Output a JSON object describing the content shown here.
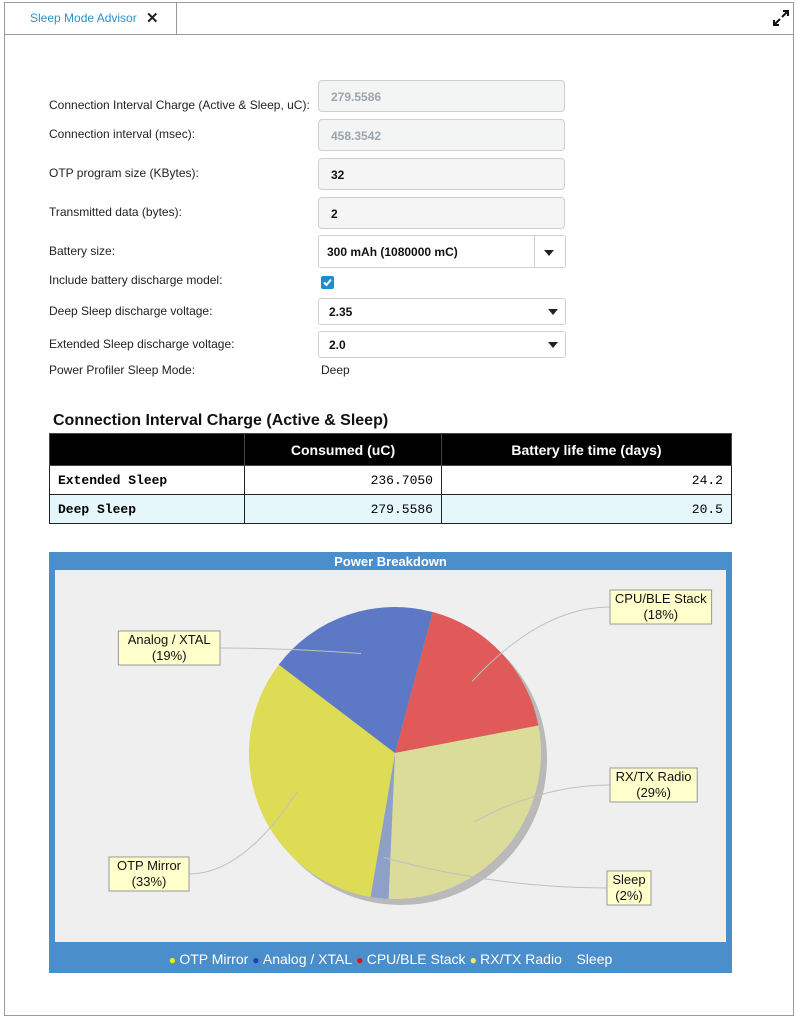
{
  "tab": {
    "title": "Sleep Mode Advisor",
    "close_icon": "close-icon",
    "maximize_icon": "maximize-icon"
  },
  "form": {
    "rows": [
      {
        "label": "Connection Interval Charge (Active & Sleep, uC):",
        "value": "279.5586"
      },
      {
        "label": "Connection interval (msec):",
        "value": "458.3542"
      },
      {
        "label": "OTP program size (KBytes):",
        "value": "32"
      },
      {
        "label": "Transmitted data (bytes):",
        "value": "2"
      }
    ],
    "battery_size": {
      "label": "Battery size:",
      "value": "300 mAh (1080000 mC)"
    },
    "discharge_model": {
      "label": "Include battery discharge model:",
      "checked": true
    },
    "deep_sleep_voltage": {
      "label": "Deep Sleep discharge voltage:",
      "value": "2.35"
    },
    "extended_sleep_voltage": {
      "label": "Extended Sleep discharge voltage:",
      "value": "2.0"
    },
    "sleep_mode": {
      "label": "Power Profiler Sleep Mode:",
      "value": "Deep"
    }
  },
  "table": {
    "title": "Connection Interval Charge (Active & Sleep)",
    "headers": [
      "",
      "Consumed (uC)",
      "Battery life time (days)"
    ],
    "rows": [
      {
        "name": "Extended Sleep",
        "consumed": "236.7050",
        "life": "24.2"
      },
      {
        "name": "Deep Sleep",
        "consumed": "279.5586",
        "life": "20.5"
      }
    ]
  },
  "chart_data": {
    "type": "pie",
    "title": "Power Breakdown",
    "slices": [
      {
        "name": "CPU/BLE Stack",
        "percent": 18,
        "color": "#e05a5a"
      },
      {
        "name": "RX/TX Radio",
        "percent": 29,
        "color": "#dcdc9a"
      },
      {
        "name": "Sleep",
        "percent": 2,
        "color": "#8fa0c8"
      },
      {
        "name": "OTP Mirror",
        "percent": 33,
        "color": "#dedc55"
      },
      {
        "name": "Analog / XTAL",
        "percent": 19,
        "color": "#5d78c4"
      }
    ],
    "labels": [
      "CPU/BLE Stack\n(18%)",
      "RX/TX Radio\n(29%)",
      "Sleep\n(2%)",
      "OTP Mirror\n(33%)",
      "Analog / XTAL\n(19%)"
    ],
    "legend": [
      {
        "name": "OTP Mirror",
        "color": "#f5f000"
      },
      {
        "name": "Analog / XTAL",
        "color": "#1f3fb0"
      },
      {
        "name": "CPU/BLE Stack",
        "color": "#e01010"
      },
      {
        "name": "RX/TX Radio",
        "color": "#f0ee60"
      },
      {
        "name": "Sleep",
        "color": "#4a8fcc"
      }
    ],
    "legend_position": "bottom"
  }
}
